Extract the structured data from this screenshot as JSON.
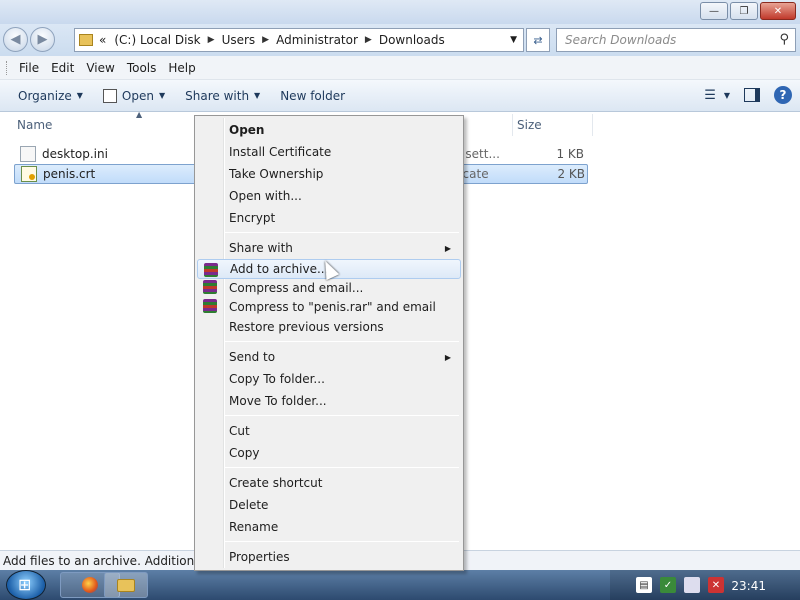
{
  "window": {
    "controls": [
      "minimize",
      "maximize",
      "close"
    ]
  },
  "navigation": {
    "back_icon": "back-arrow",
    "forward_icon": "forward-arrow",
    "address": {
      "prefix": "«",
      "segments": [
        "(C:) Local Disk",
        "Users",
        "Administrator",
        "Downloads"
      ]
    },
    "search_placeholder": "Search Downloads"
  },
  "menubar": {
    "items": [
      "File",
      "Edit",
      "View",
      "Tools",
      "Help"
    ]
  },
  "toolbar": {
    "organize": "Organize",
    "open": "Open",
    "share_with": "Share with",
    "new_folder": "New folder"
  },
  "columns": {
    "name": "Name",
    "size": "Size"
  },
  "files": [
    {
      "name": "desktop.ini",
      "type": "n sett...",
      "size": "1 KB",
      "selected": false
    },
    {
      "name": "penis.crt",
      "type": "ficate",
      "size": "2 KB",
      "selected": true
    }
  ],
  "context_menu": {
    "open": "Open",
    "install_certificate": "Install Certificate",
    "take_ownership": "Take Ownership",
    "open_with": "Open with...",
    "encrypt": "Encrypt",
    "share_with": "Share with",
    "add_to_archive": "Add to archive...",
    "compress_email": "Compress and email...",
    "compress_rar_email": "Compress to \"penis.rar\" and email",
    "restore_versions": "Restore previous versions",
    "send_to": "Send to",
    "copy_to_folder": "Copy To folder...",
    "move_to_folder": "Move To folder...",
    "cut": "Cut",
    "copy": "Copy",
    "create_shortcut": "Create shortcut",
    "delete": "Delete",
    "rename": "Rename",
    "properties": "Properties"
  },
  "status_bar": {
    "text": "Add files to an archive. Additional op"
  },
  "taskbar": {
    "clock": "23:41"
  }
}
